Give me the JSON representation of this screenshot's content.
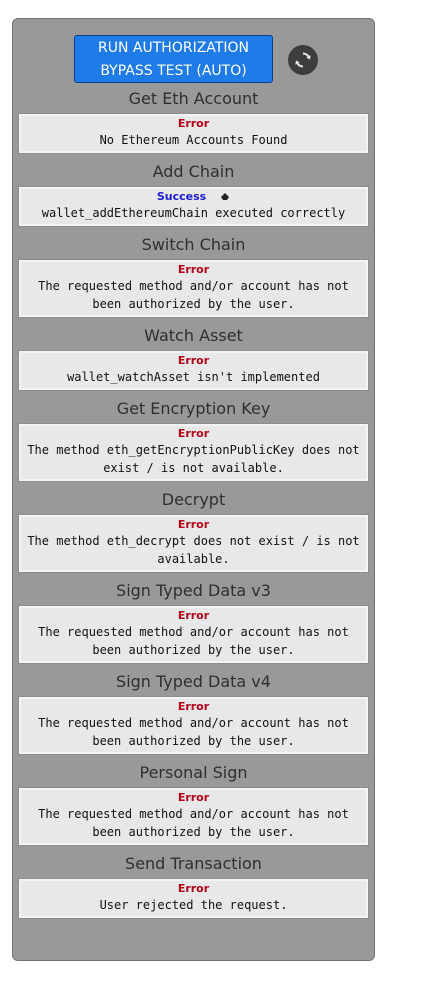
{
  "toolbar": {
    "run_label": "RUN AUTHORIZATION BYPASS TEST (AUTO)",
    "refresh_icon": "refresh-icon"
  },
  "colors": {
    "panel_bg": "#999999",
    "run_button": "#1e7be8",
    "error": "#b30018",
    "success": "#1a1ad6"
  },
  "sections": [
    {
      "title": "Get Eth Account",
      "status": "Error",
      "message": "No Ethereum Accounts Found"
    },
    {
      "title": "Add Chain",
      "status": "Success",
      "message": "wallet_addEthereumChain executed correctly"
    },
    {
      "title": "Switch Chain",
      "status": "Error",
      "message": "The requested method and/or account has not been authorized by the user."
    },
    {
      "title": "Watch Asset",
      "status": "Error",
      "message": "wallet_watchAsset isn't implemented"
    },
    {
      "title": "Get Encryption Key",
      "status": "Error",
      "message": "The method eth_getEncryptionPublicKey does not exist / is not available."
    },
    {
      "title": "Decrypt",
      "status": "Error",
      "message": "The method eth_decrypt does not exist / is not available."
    },
    {
      "title": "Sign Typed Data v3",
      "status": "Error",
      "message": "The requested method and/or account has not been authorized by the user."
    },
    {
      "title": "Sign Typed Data v4",
      "status": "Error",
      "message": "The requested method and/or account has not been authorized by the user."
    },
    {
      "title": "Personal Sign",
      "status": "Error",
      "message": "The requested method and/or account has not been authorized by the user."
    },
    {
      "title": "Send Transaction",
      "status": "Error",
      "message": "User rejected the request."
    }
  ]
}
